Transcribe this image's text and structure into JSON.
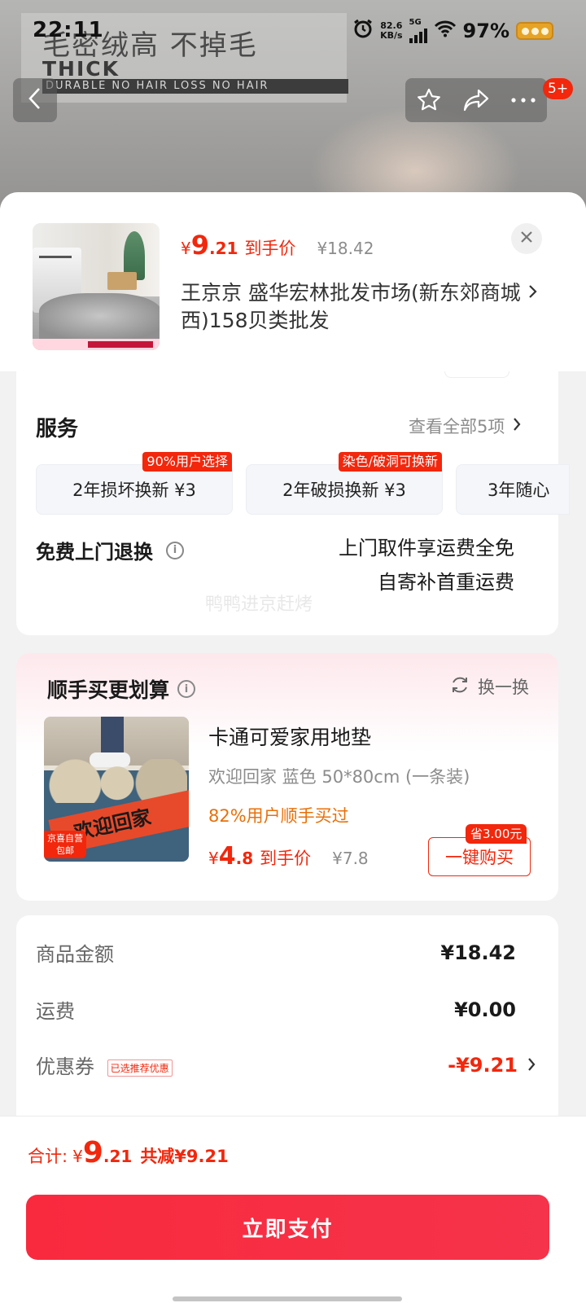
{
  "status_bar": {
    "time": "22:11",
    "net_speed_value": "82.6",
    "net_speed_unit": "KB/s",
    "network": "5G",
    "battery": "97%"
  },
  "banner": {
    "cn_text": "毛密绒高 不掉毛",
    "en_line1": "THICK",
    "en_line2": "DURABLE NO HAIR LOSS NO HAIR"
  },
  "nav": {
    "back_icon": "chevron-left-icon",
    "badge": "5+"
  },
  "product": {
    "price_symbol": "¥",
    "price_int": "9",
    "price_dec": ".21",
    "price_label": "到手价",
    "original_price": "¥18.42",
    "address": "王京京  盛华宏林批发市场(新东郊商城西)158贝类批发"
  },
  "services": {
    "title": "服务",
    "view_all": "查看全部5项",
    "chips": [
      {
        "label": "2年损坏换新  ¥3",
        "tag": "90%用户选择"
      },
      {
        "label": "2年破损换新  ¥3",
        "tag": "染色/破洞可换新"
      },
      {
        "label": "3年随心",
        "tag": ""
      }
    ],
    "return_title": "免费上门退换",
    "return_line1": "上门取件享运费全免",
    "return_line2": "自寄补首重运费",
    "watermark": "鸭鸭进京赶烤"
  },
  "bundle": {
    "title": "顺手买更划算",
    "refresh": "换一换",
    "image_text": "欢迎回家",
    "image_tag": "京喜自营 包邮",
    "name": "卡通可爱家用地垫",
    "spec": "欢迎回家 蓝色  50*80cm (一条装)",
    "stat": "82%用户顺手买过",
    "price_symbol": "¥",
    "price_int": "4",
    "price_dec": ".8",
    "price_label": "到手价",
    "original_price": "¥7.8",
    "save_tag": "省3.00元",
    "buy_label": "一键购买"
  },
  "amounts": {
    "goods_label": "商品金额",
    "goods_value": "¥18.42",
    "shipping_label": "运费",
    "shipping_value": "¥0.00",
    "coupon_label": "优惠券",
    "coupon_tag": "已选推荐优惠",
    "coupon_value": "-¥9.21"
  },
  "footer": {
    "total_label": "合计:",
    "total_symbol": "¥",
    "total_int": "9",
    "total_dec": ".21",
    "reduce_text": "共减¥9.21",
    "pay_label": "立即支付"
  },
  "colors": {
    "accent_red": "#f2270c",
    "pay_button": "#f92a3e",
    "orange_text": "#e8700a"
  }
}
